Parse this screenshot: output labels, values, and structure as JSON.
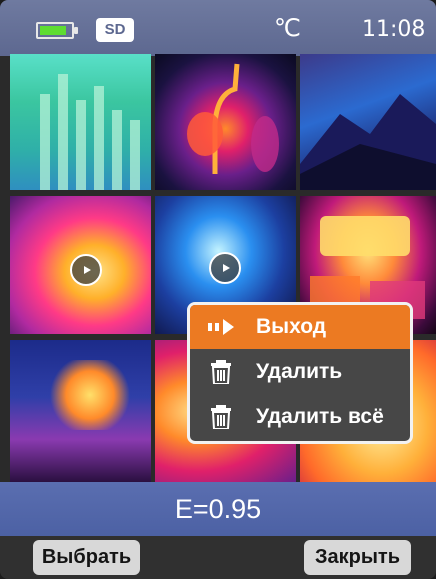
{
  "status_bar": {
    "battery_icon": "battery-icon",
    "battery_level": 0.8,
    "sd_label": "SD",
    "temperature_unit": "℃",
    "time": "11:08"
  },
  "gallery": {
    "thumbnails": [
      {
        "type": "image"
      },
      {
        "type": "image"
      },
      {
        "type": "image"
      },
      {
        "type": "video",
        "icon": "play-icon"
      },
      {
        "type": "video",
        "icon": "play-icon"
      },
      {
        "type": "image"
      },
      {
        "type": "image"
      },
      {
        "type": "image"
      },
      {
        "type": "image"
      }
    ]
  },
  "context_menu": {
    "items": [
      {
        "label": "Выход",
        "icon": "play-pause-icon",
        "selected": true
      },
      {
        "label": "Удалить",
        "icon": "trash-icon",
        "selected": false
      },
      {
        "label": "Удалить всё",
        "icon": "trash-icon",
        "selected": false
      }
    ]
  },
  "emissivity": {
    "label": "E=0.95"
  },
  "bottom_bar": {
    "select_label": "Выбрать",
    "close_label": "Закрыть"
  },
  "colors": {
    "status_bar": "#5d6890",
    "selected_item": "#ec7a22",
    "menu_bg": "#474747",
    "emissivity_bar": "#4c61a4",
    "softkey": "#d8d8d8"
  }
}
